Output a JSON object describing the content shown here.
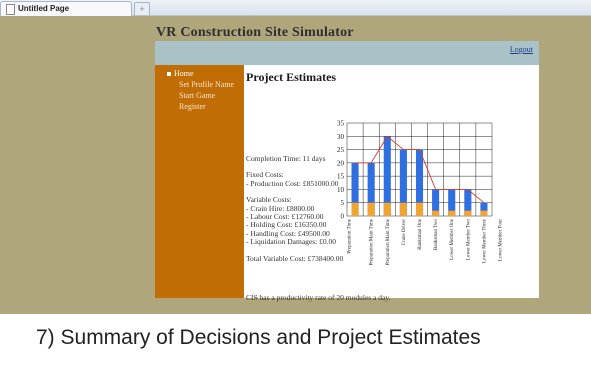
{
  "browser": {
    "tab_title": "Untitled Page",
    "new_tab_glyph": "+"
  },
  "site": {
    "title": "VR Construction Site Simulator",
    "logout_label": "Logout"
  },
  "nav": {
    "home_label": "Home",
    "items": [
      {
        "label": "Set Profile Name"
      },
      {
        "label": "Start Game"
      },
      {
        "label": "Register"
      }
    ]
  },
  "content": {
    "heading": "Project Estimates",
    "completion_time": "Completion Time: 11 days",
    "fixed_costs_title": "Fixed Costs:",
    "production_cost": "- Production Cost: £851000.00",
    "variable_costs_title": "Variable Costs:",
    "variable_costs": [
      "- Crain Hire: £8800.00",
      "- Labour Cost: £12760.00",
      "- Holding Cost: £16350.00",
      "- Handling Cost: £49500.00",
      "- Liquidation Damages: £0.00"
    ],
    "total_variable_cost": "Total Variable Cost: £738400.00",
    "productivity": "CIS has a productivity rate of 20 modules a day."
  },
  "caption": "7) Summary of Decisions and Project Estimates",
  "chart_data": {
    "type": "bar",
    "categories": [
      "Preparation Time",
      "Preparation Main Time",
      "Preparation Main Time",
      "Crane Driver",
      "Banksman One",
      "Banksman Two",
      "Lower Member One",
      "Lower Member Two",
      "Lower Member Three",
      "Lower Member Four"
    ],
    "series": [
      {
        "values": [
          20,
          20,
          30,
          25,
          25,
          10,
          10,
          10,
          5
        ],
        "color": "#2f6fe0"
      },
      {
        "values": [
          5,
          5,
          5,
          5,
          5,
          2,
          2,
          2,
          2
        ],
        "color": "#f0a532"
      }
    ],
    "line": {
      "values": [
        20,
        20,
        30,
        25,
        25,
        10,
        10,
        10,
        5
      ],
      "color": "#d63b2e"
    },
    "ylim": [
      0,
      35
    ],
    "yticks": [
      "0",
      "5",
      "10",
      "15",
      "20",
      "25",
      "30",
      "35"
    ],
    "grid": true
  }
}
